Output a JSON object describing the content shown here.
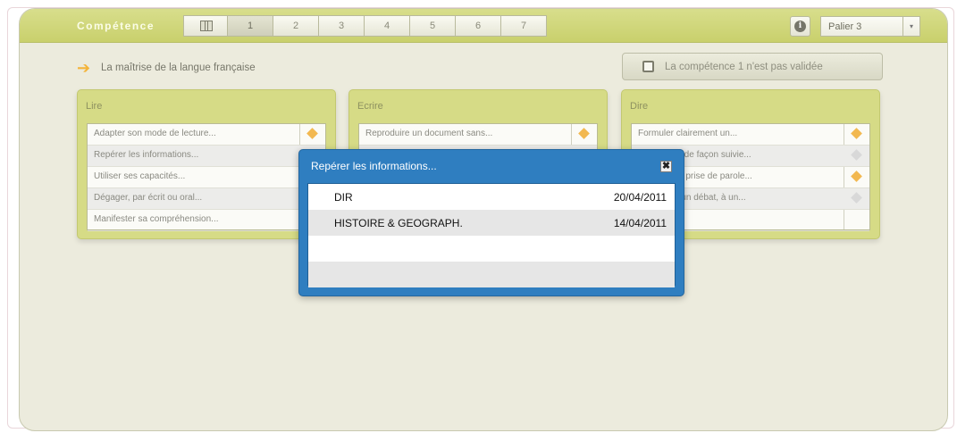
{
  "header": {
    "title": "Compétence",
    "tabs": [
      "1",
      "2",
      "3",
      "4",
      "5",
      "6",
      "7"
    ],
    "info_icon": "info-icon",
    "palier": "Palier 3",
    "dropdown_arrow": "▾"
  },
  "subheader": {
    "text": "La maîtrise de la langue française",
    "arrow_icon": "➔",
    "validate_label": "La compétence 1 n'est pas validée"
  },
  "cards": [
    {
      "title": "Lire",
      "items": [
        {
          "label": "Adapter son mode de lecture...",
          "status": "orange"
        },
        {
          "label": "Repérer les informations...",
          "status": "none"
        },
        {
          "label": "Utiliser ses capacités...",
          "status": "none"
        },
        {
          "label": "Dégager, par écrit ou oral...",
          "status": "none"
        },
        {
          "label": "Manifester sa compréhension...",
          "status": "none"
        }
      ]
    },
    {
      "title": "Ecrire",
      "items": [
        {
          "label": "Reproduire un document sans...",
          "status": "orange"
        },
        {
          "label": "",
          "status": "none"
        },
        {
          "label": "",
          "status": "none"
        },
        {
          "label": "",
          "status": "none"
        },
        {
          "label": "",
          "status": "none"
        }
      ]
    },
    {
      "title": "Dire",
      "items": [
        {
          "label": "Formuler clairement un...",
          "status": "orange"
        },
        {
          "label": "er de façon suivie...",
          "status": "grey"
        },
        {
          "label": "se prise de parole...",
          "status": "orange"
        },
        {
          "label": "à un débat, à un...",
          "status": "grey"
        },
        {
          "label": "",
          "status": "none"
        }
      ]
    }
  ],
  "modal": {
    "title": "Repérer les informations...",
    "close_icon": "✖",
    "rows": [
      {
        "name": "DIR",
        "date": "20/04/2011"
      },
      {
        "name": "HISTOIRE & GEOGRAPH.",
        "date": "14/04/2011"
      },
      {
        "name": "",
        "date": ""
      },
      {
        "name": "",
        "date": ""
      }
    ]
  },
  "colors": {
    "header_bar": "#d3d97c",
    "modal_blue": "#2f7ec0",
    "diamond_orange": "#f2b850",
    "diamond_grey": "#d8d8d8"
  }
}
